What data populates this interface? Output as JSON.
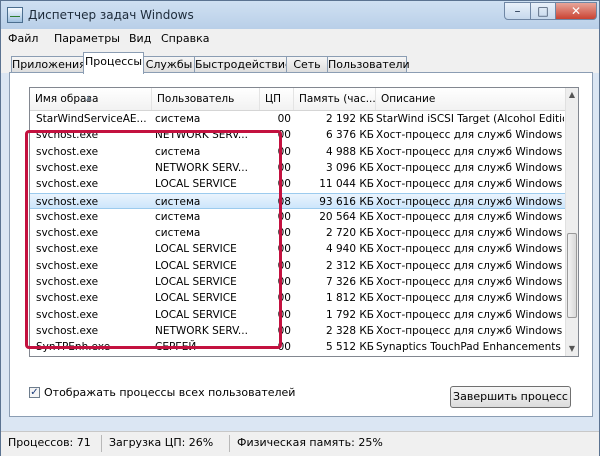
{
  "window": {
    "title": "Диспетчер задач Windows",
    "icon": "task-manager-icon"
  },
  "controls": {
    "minimize": "–",
    "maximize": "□",
    "close": "✕"
  },
  "menu": [
    "Файл",
    "Параметры",
    "Вид",
    "Справка"
  ],
  "tabs": [
    "Приложения",
    "Процессы",
    "Службы",
    "Быстродействие",
    "Сеть",
    "Пользователи"
  ],
  "active_tab": "Процессы",
  "columns": [
    "Имя образа",
    "Пользователь",
    "ЦП",
    "Память (час...",
    "Описание"
  ],
  "processes": [
    {
      "name": "StarWindServiceAE...",
      "user": "система",
      "cpu": "00",
      "mem": "2 192 КБ",
      "desc": "StarWind iSCSI Target (Alcohol Edition)"
    },
    {
      "name": "svchost.exe",
      "user": "NETWORK SERV...",
      "cpu": "00",
      "mem": "6 376 КБ",
      "desc": "Хост-процесс для служб Windows"
    },
    {
      "name": "svchost.exe",
      "user": "система",
      "cpu": "00",
      "mem": "4 988 КБ",
      "desc": "Хост-процесс для служб Windows"
    },
    {
      "name": "svchost.exe",
      "user": "NETWORK SERV...",
      "cpu": "00",
      "mem": "3 096 КБ",
      "desc": "Хост-процесс для служб Windows"
    },
    {
      "name": "svchost.exe",
      "user": "LOCAL SERVICE",
      "cpu": "00",
      "mem": "11 044 КБ",
      "desc": "Хост-процесс для служб Windows"
    },
    {
      "name": "svchost.exe",
      "user": "система",
      "cpu": "08",
      "mem": "93 616 КБ",
      "desc": "Хост-процесс для служб Windows"
    },
    {
      "name": "svchost.exe",
      "user": "система",
      "cpu": "00",
      "mem": "20 564 КБ",
      "desc": "Хост-процесс для служб Windows"
    },
    {
      "name": "svchost.exe",
      "user": "система",
      "cpu": "00",
      "mem": "2 720 КБ",
      "desc": "Хост-процесс для служб Windows"
    },
    {
      "name": "svchost.exe",
      "user": "LOCAL SERVICE",
      "cpu": "00",
      "mem": "4 940 КБ",
      "desc": "Хост-процесс для служб Windows"
    },
    {
      "name": "svchost.exe",
      "user": "LOCAL SERVICE",
      "cpu": "00",
      "mem": "2 312 КБ",
      "desc": "Хост-процесс для служб Windows"
    },
    {
      "name": "svchost.exe",
      "user": "LOCAL SERVICE",
      "cpu": "00",
      "mem": "7 326 КБ",
      "desc": "Хост-процесс для служб Windows"
    },
    {
      "name": "svchost.exe",
      "user": "LOCAL SERVICE",
      "cpu": "00",
      "mem": "1 812 КБ",
      "desc": "Хост-процесс для служб Windows"
    },
    {
      "name": "svchost.exe",
      "user": "LOCAL SERVICE",
      "cpu": "00",
      "mem": "1 792 КБ",
      "desc": "Хост-процесс для служб Windows"
    },
    {
      "name": "svchost.exe",
      "user": "NETWORK SERV...",
      "cpu": "00",
      "mem": "2 328 КБ",
      "desc": "Хост-процесс для служб Windows"
    },
    {
      "name": "SynTPEnh.exe",
      "user": "СЕРГЕЙ",
      "cpu": "00",
      "mem": "5 512 КБ",
      "desc": "Synaptics TouchPad Enhancements"
    }
  ],
  "selected_row": 5,
  "show_all_users": {
    "label": "Отображать процессы всех пользователей",
    "checked": true
  },
  "end_process_label": "Завершить процесс",
  "status": {
    "processes": "Процессов: 71",
    "cpu": "Загрузка ЦП: 26%",
    "memory": "Физическая память: 25%"
  },
  "colors": {
    "highlight_border": "#c3113f",
    "titlebar": "#b9cfe8",
    "selection": "#cde6fb"
  }
}
